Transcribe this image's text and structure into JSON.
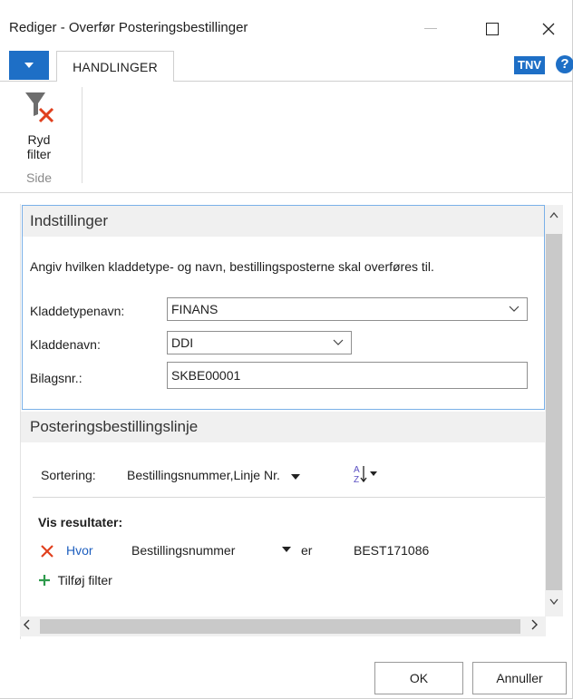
{
  "window": {
    "title": "Rediger - Overfør Posteringsbestillinger",
    "minimize_glyph": "—",
    "maximize_glyph": "☐",
    "close_glyph": "✕"
  },
  "ribbon": {
    "tab_label": "HANDLINGER",
    "badge": "TNV",
    "help_glyph": "?",
    "clear_filter_label": "Ryd filter",
    "clear_filter_line1": "Ryd",
    "clear_filter_line2": "filter",
    "group_label": "Side",
    "accent_color": "#1e6fc6"
  },
  "settings": {
    "title": "Indstillinger",
    "instruction": "Angiv hvilken kladdetype- og navn, bestillingsposterne skal overføres til.",
    "fields": [
      {
        "label": "Kladdetypenavn:",
        "value": "FINANS"
      },
      {
        "label": "Kladdenavn:",
        "value": "DDI"
      },
      {
        "label": "Bilagsnr.:",
        "value": "SKBE00001"
      }
    ]
  },
  "lines": {
    "title": "Posteringsbestillingslinje",
    "sort_label": "Sortering:",
    "sort_value": "Bestillingsnummer,Linje Nr.",
    "results_label": "Vis resultater:",
    "filter": {
      "where_label": "Hvor",
      "field": "Bestillingsnummer",
      "operator": "er",
      "value": "BEST171086"
    },
    "add_filter_label": "Tilføj filter"
  },
  "footer": {
    "ok_label": "OK",
    "cancel_label": "Annuller"
  }
}
